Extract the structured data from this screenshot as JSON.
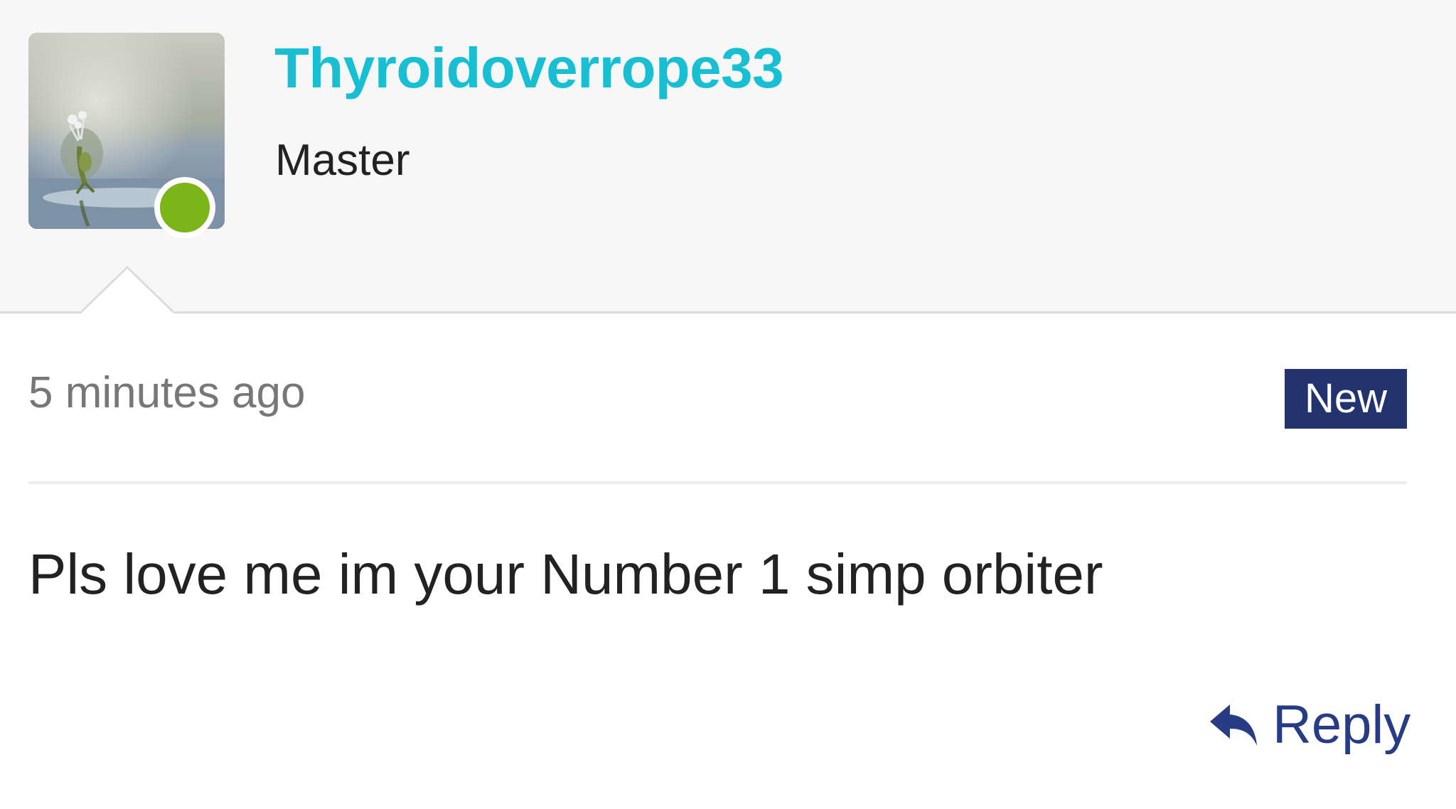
{
  "author": {
    "username": "Thyroidoverrope33",
    "rank": "Master",
    "online": true,
    "online_color": "#7cb518",
    "username_color": "#18bfd3"
  },
  "post": {
    "timestamp": "5 minutes ago",
    "badge": "New",
    "badge_color": "#22336e",
    "body": "Pls love me im your Number 1 simp orbiter"
  },
  "actions": {
    "reply_label": "Reply",
    "reply_icon": "reply-arrow-icon"
  }
}
